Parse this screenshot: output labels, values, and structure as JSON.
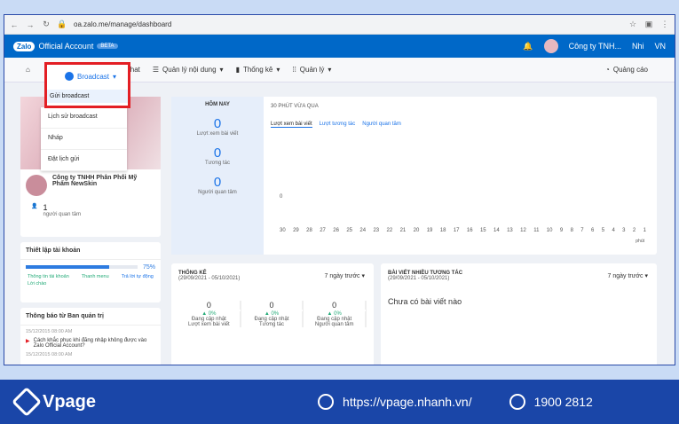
{
  "browser": {
    "url": "oa.zalo.me/manage/dashboard"
  },
  "header": {
    "brand": "Zalo",
    "title": "Official Account",
    "badge": "BETA",
    "company": "Công ty TNH...",
    "user": "Nhi",
    "lang": "VN"
  },
  "menu": {
    "broadcast": "Broadcast",
    "chat": "Chat",
    "content": "Quản lý nội dung",
    "stats": "Thống kê",
    "manage": "Quản lý",
    "ads": "Quảng cáo"
  },
  "dropdown": {
    "send": "Gửi broadcast",
    "history": "Lịch sử broadcast",
    "draft": "Nháp",
    "schedule": "Đặt lịch gửi"
  },
  "profile": {
    "name": "Công ty TNHH Phân Phối Mỹ Phẩm NewSkin",
    "followers": "1",
    "followers_label": "người quan tâm"
  },
  "setup": {
    "title": "Thiết lập tài khoản",
    "percent": "75%",
    "progress": 0.75,
    "items": [
      "Thông tin tài khoản",
      "Thanh menu",
      "Trả lời tự động",
      "Lời chào"
    ]
  },
  "notice": {
    "title": "Thông báo từ Ban quản trị",
    "date1": "15/12/2015 08:00 AM",
    "text1": "Cách khắc phục khi đăng nhập không được vào Zalo Official Account?",
    "date2": "15/12/2015 08:00 AM"
  },
  "today": {
    "label": "HÔM NAY",
    "v1": "0",
    "l1": "Lượt xem bài viết",
    "v2": "0",
    "l2": "Tương tác",
    "v3": "0",
    "l3": "Người quan tâm"
  },
  "chart": {
    "label": "30 PHÚT VỪA QUA",
    "tabs": [
      "Lượt xem bài viết",
      "Lượt tương tác",
      "Người quan tâm"
    ],
    "zero": "0",
    "ticks": [
      "30",
      "29",
      "28",
      "27",
      "26",
      "25",
      "24",
      "23",
      "22",
      "21",
      "20",
      "19",
      "18",
      "17",
      "16",
      "15",
      "14",
      "13",
      "12",
      "11",
      "10",
      "9",
      "8",
      "7",
      "6",
      "5",
      "4",
      "3",
      "2",
      "1"
    ],
    "unit": "phút"
  },
  "stats": {
    "title": "THỐNG KÊ",
    "range": "(29/09/2021 - 05/10/2021)",
    "select": "7 ngày trước",
    "items": [
      {
        "v": "0",
        "d": "0%",
        "s": "Đang cập nhật",
        "l": "Lượt xem bài viết"
      },
      {
        "v": "0",
        "d": "0%",
        "s": "Đang cập nhật",
        "l": "Tương tác"
      },
      {
        "v": "0",
        "d": "0%",
        "s": "Đang cập nhật",
        "l": "Người quan tâm"
      }
    ]
  },
  "posts": {
    "title": "BÀI VIẾT NHIỀU TƯƠNG TÁC",
    "range": "(29/09/2021 - 05/10/2021)",
    "select": "7 ngày trước",
    "empty": "Chưa có bài viết nào"
  },
  "footer": {
    "brand": "Vpage",
    "site": "https://vpage.nhanh.vn/",
    "phone": "1900 2812"
  }
}
